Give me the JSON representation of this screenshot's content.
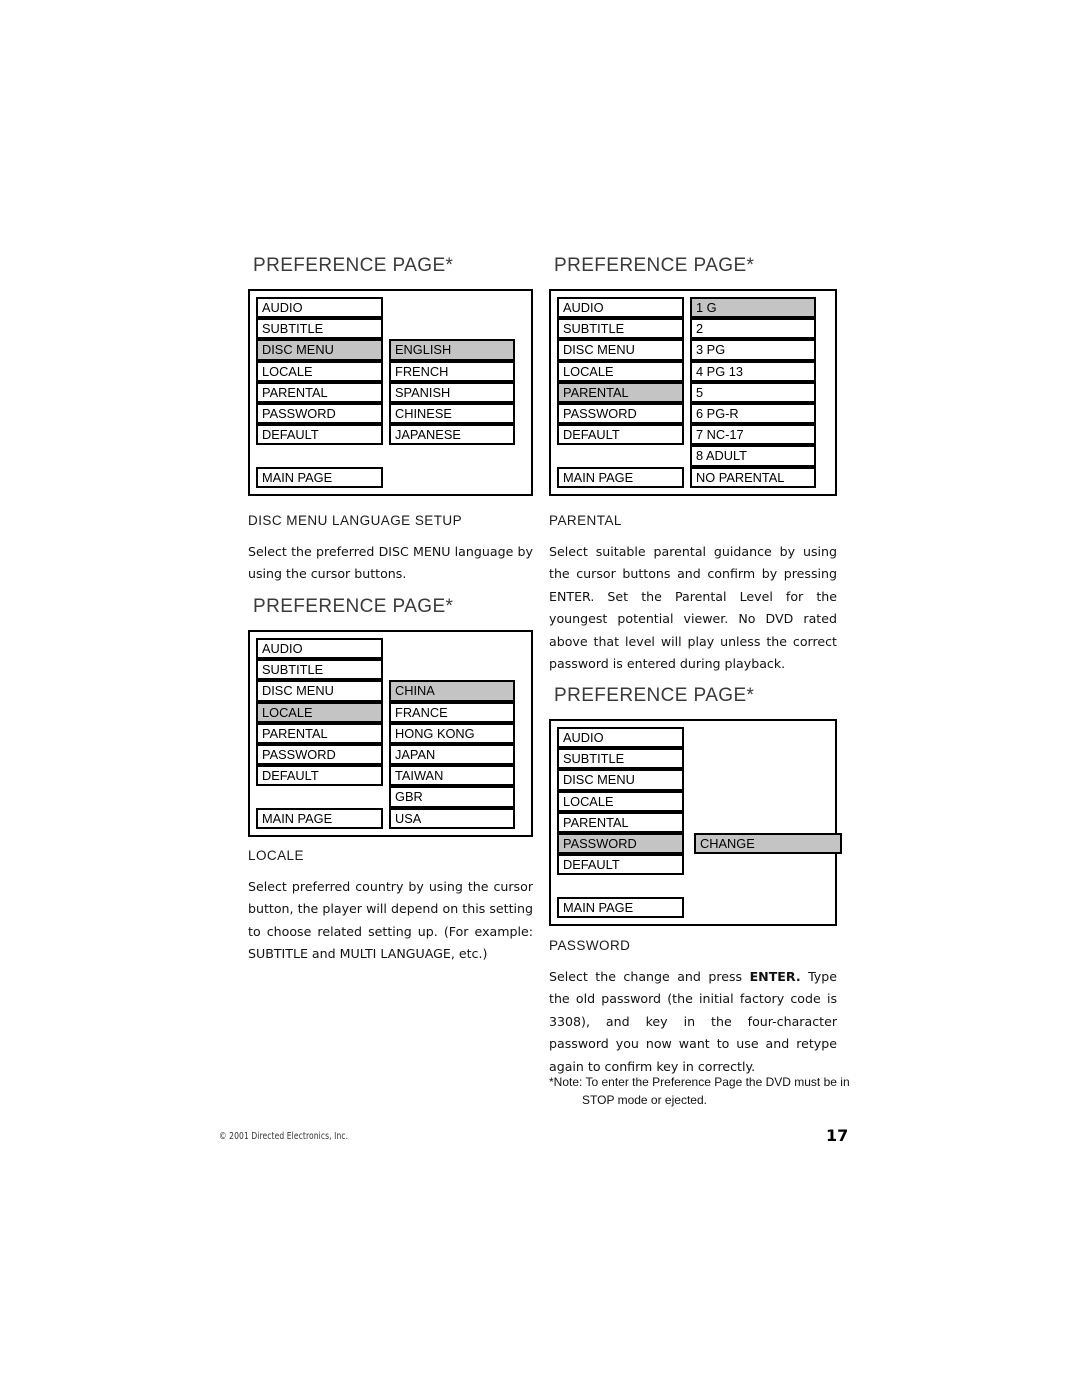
{
  "page": {
    "number": "17",
    "copyright": "© 2001 Directed Electronics, Inc."
  },
  "panels": {
    "disc_menu": {
      "title": "PREFERENCE PAGE*",
      "left_items": [
        "AUDIO",
        "SUBTITLE",
        "DISC MENU",
        "LOCALE",
        "PARENTAL",
        "PASSWORD",
        "DEFAULT"
      ],
      "left_selected": "DISC MENU",
      "main_page_label": "MAIN PAGE",
      "right_items": [
        "ENGLISH",
        "FRENCH",
        "SPANISH",
        "CHINESE",
        "JAPANESE"
      ],
      "right_selected": "ENGLISH",
      "right_start_row": 3
    },
    "parental": {
      "title": "PREFERENCE PAGE*",
      "left_items": [
        "AUDIO",
        "SUBTITLE",
        "DISC MENU",
        "LOCALE",
        "PARENTAL",
        "PASSWORD",
        "DEFAULT"
      ],
      "left_selected": "PARENTAL",
      "main_page_label": "MAIN PAGE",
      "right_items": [
        "1 G",
        "2",
        "3 PG",
        "4 PG 13",
        "5",
        "6 PG-R",
        "7 NC-17",
        "8 ADULT",
        "NO PARENTAL"
      ],
      "right_selected": "1 G",
      "right_start_row": 1
    },
    "locale": {
      "title": "PREFERENCE PAGE*",
      "left_items": [
        "AUDIO",
        "SUBTITLE",
        "DISC MENU",
        "LOCALE",
        "PARENTAL",
        "PASSWORD",
        "DEFAULT"
      ],
      "left_selected": "LOCALE",
      "main_page_label": "MAIN PAGE",
      "right_items": [
        "CHINA",
        "FRANCE",
        "HONG KONG",
        "JAPAN",
        "TAIWAN",
        "GBR",
        "USA"
      ],
      "right_selected": "CHINA",
      "right_start_row": 3
    },
    "password": {
      "title": "PREFERENCE PAGE*",
      "left_items": [
        "AUDIO",
        "SUBTITLE",
        "DISC MENU",
        "LOCALE",
        "PARENTAL",
        "PASSWORD",
        "DEFAULT"
      ],
      "left_selected": "PASSWORD",
      "main_page_label": "MAIN PAGE",
      "right_items": [
        "CHANGE"
      ],
      "right_selected": "CHANGE",
      "right_start_row": 6
    }
  },
  "sections": {
    "disc_menu": {
      "heading": "DISC MENU LANGUAGE SETUP",
      "body": "Select the preferred DISC MENU language by using the cursor buttons."
    },
    "locale": {
      "heading": "LOCALE",
      "body": "Select preferred country by using the cursor button, the player will depend on this setting to choose related setting up. (For example: SUBTITLE and MULTI LANGUAGE, etc.)"
    },
    "parental": {
      "heading": "PARENTAL",
      "body": "Select suitable parental guidance by using the cursor buttons and confirm by pressing ENTER. Set the Parental Level for the youngest potential viewer. No DVD rated above that level will play unless the correct password is entered during playback."
    },
    "password": {
      "heading": "PASSWORD",
      "body_part1": "Select the change and press ",
      "body_emphasis": "ENTER.",
      "body_part2": " Type the old password (the initial factory code is 3308), and key in the four-character password you now want to use and retype again to confirm key in correctly."
    }
  },
  "footnote": {
    "line1": "*Note: To enter the Preference Page the DVD must be in",
    "line2": "STOP mode or ejected."
  },
  "colors": {
    "highlight": "#c4c4c4",
    "border": "#000000",
    "title_gray": "#3a3a3a"
  }
}
